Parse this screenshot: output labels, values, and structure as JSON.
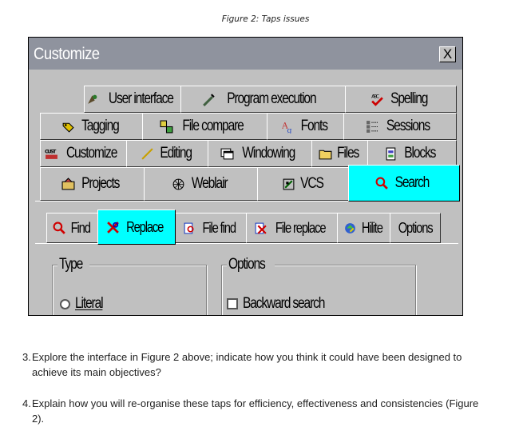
{
  "caption": "Figure 2: Taps issues",
  "window": {
    "title": "Customize",
    "close_label": "X"
  },
  "tabs_row1": [
    {
      "label": "User interface",
      "icon": "user-interface-icon"
    },
    {
      "label": "Program execution",
      "icon": "program-execution-icon"
    },
    {
      "label": "Spelling",
      "icon": "spelling-icon"
    }
  ],
  "tabs_row2": [
    {
      "label": "Tagging",
      "icon": "tagging-icon"
    },
    {
      "label": "File compare",
      "icon": "file-compare-icon"
    },
    {
      "label": "Fonts",
      "icon": "fonts-icon"
    },
    {
      "label": "Sessions",
      "icon": "sessions-icon"
    }
  ],
  "tabs_row3": [
    {
      "label": "Customize",
      "icon": "customize-icon"
    },
    {
      "label": "Editing",
      "icon": "editing-icon"
    },
    {
      "label": "Windowing",
      "icon": "windowing-icon"
    },
    {
      "label": "Files",
      "icon": "files-icon"
    },
    {
      "label": "Blocks",
      "icon": "blocks-icon"
    }
  ],
  "tabs_row4": [
    {
      "label": "Projects",
      "icon": "projects-icon"
    },
    {
      "label": "Weblair",
      "icon": "weblair-icon"
    },
    {
      "label": "VCS",
      "icon": "vcs-icon"
    },
    {
      "label": "Search",
      "icon": "search-icon",
      "active": true
    }
  ],
  "subtabs": [
    {
      "label": "Find",
      "icon": "find-icon"
    },
    {
      "label": "Replace",
      "icon": "replace-icon",
      "active": true
    },
    {
      "label": "File find",
      "icon": "file-find-icon"
    },
    {
      "label": "File replace",
      "icon": "file-replace-icon"
    },
    {
      "label": "Hilite",
      "icon": "hilite-icon"
    },
    {
      "label": "Options",
      "icon": ""
    }
  ],
  "type_group": {
    "label": "Type",
    "option": "Literal"
  },
  "options_group": {
    "label": "Options",
    "option": "Backward search"
  },
  "questions": [
    {
      "num": "3.",
      "text": "Explore the interface in Figure 2 above; indicate how you think it could have been designed to achieve its main objectives?"
    },
    {
      "num": "4.",
      "text": "Explain how you will re-organise these taps for efficiency, effectiveness and consistencies (Figure 2)."
    }
  ],
  "colors": {
    "active_tab": "#00ffff",
    "titlebar": "#8f939e",
    "face": "#c0c0c0"
  }
}
